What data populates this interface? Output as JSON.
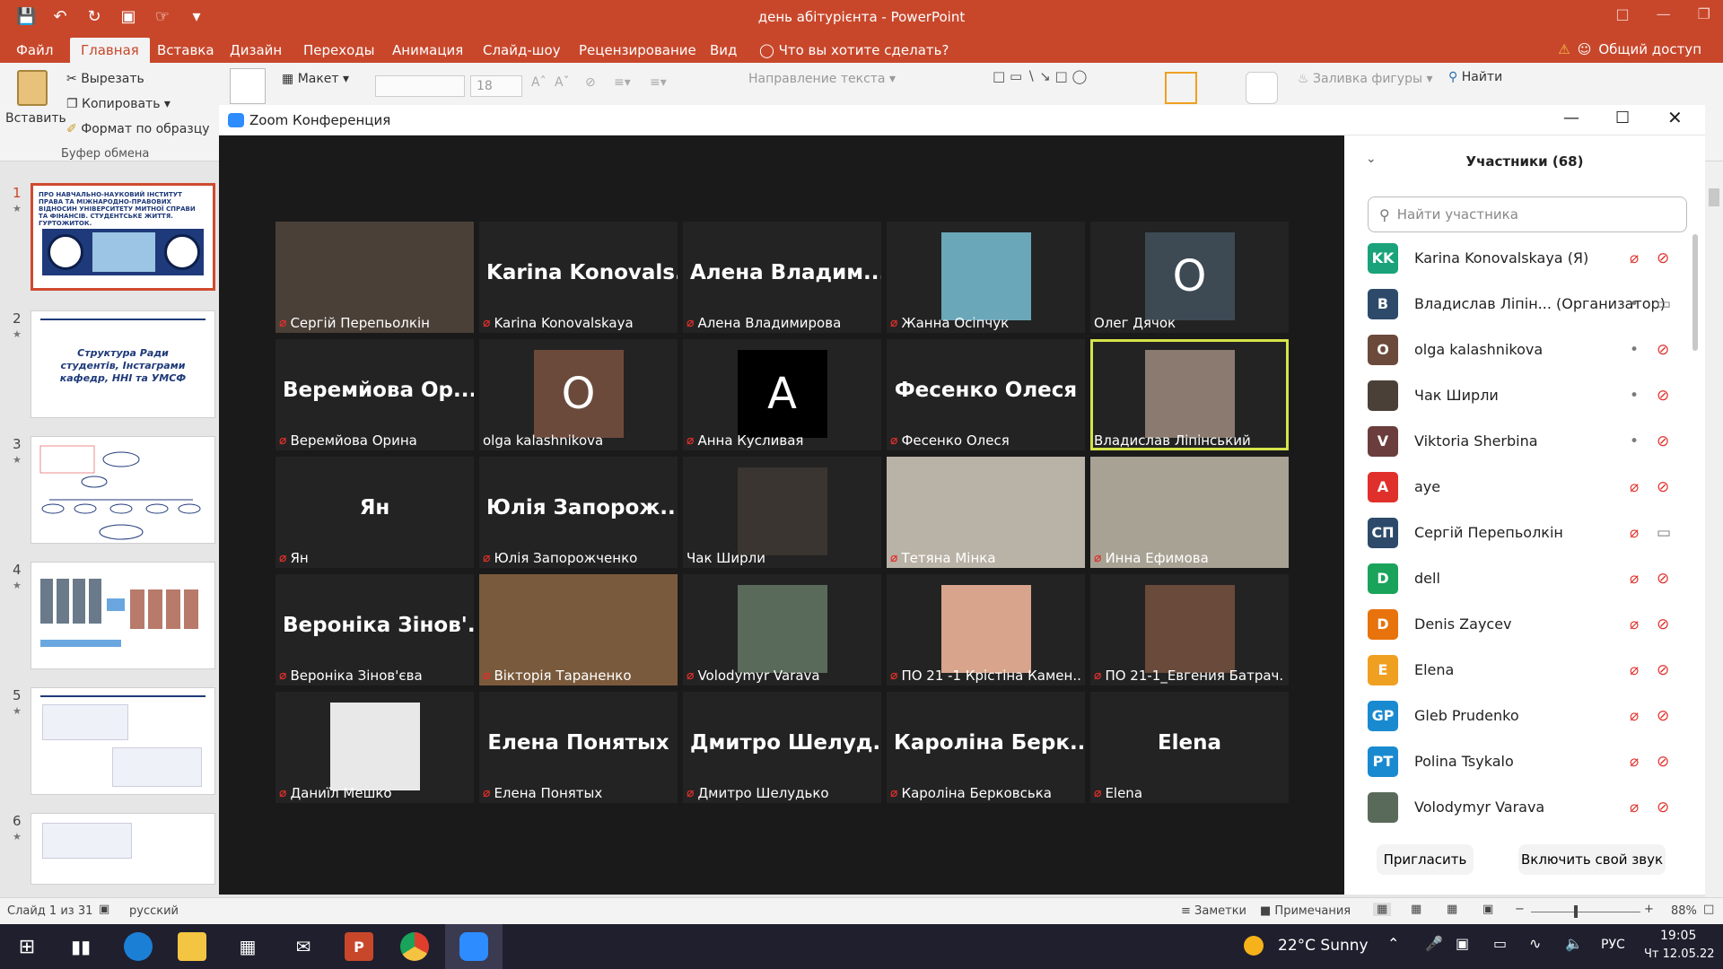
{
  "powerpoint": {
    "title": "день абітурієнта - PowerPoint",
    "tabs": [
      "Файл",
      "Главная",
      "Вставка",
      "Дизайн",
      "Переходы",
      "Анимация",
      "Слайд-шоу",
      "Рецензирование",
      "Вид"
    ],
    "tell_me": "Что вы хотите сделать?",
    "share": "Общий доступ",
    "ribbon": {
      "paste": "Вставить",
      "cut": "Вырезать",
      "copy": "Копировать",
      "format_painter": "Формат по образцу",
      "clipboard_group": "Буфер обмена",
      "layout": "Макет",
      "font_size": "18",
      "text_direction": "Направление текста",
      "shape_fill": "Заливка фигуры",
      "find": "Найти"
    },
    "slides": [
      {
        "num": "1",
        "text": "ПРО НАВЧАЛЬНО-НАУКОВИЙ ІНСТИТУТ ПРАВА ТА МІЖНАРОДНО-ПРАВОВИХ ВІДНОСИН УНІВЕРСИТЕТУ МИТНОЇ СПРАВИ ТА ФІНАНСІВ. СТУДЕНТСЬКЕ ЖИТТЯ. ГУРТОЖИТОК."
      },
      {
        "num": "2",
        "text": "Структура Ради студентів, Інстаграми кафедр, ННІ та УМСФ"
      },
      {
        "num": "3",
        "text": ""
      },
      {
        "num": "4",
        "text": ""
      },
      {
        "num": "5",
        "text": ""
      },
      {
        "num": "6",
        "text": ""
      }
    ],
    "status": {
      "slide": "Слайд 1 из 31",
      "language": "русский",
      "notes": "Заметки",
      "comments": "Примечания",
      "zoom": "88%"
    }
  },
  "zoom": {
    "window_title": "Zoom Конференция",
    "tiles": [
      {
        "label": "Сергій Перепьолкін",
        "big": "",
        "muted": true,
        "kind": "photo",
        "color": "#4a4038"
      },
      {
        "label": "Karina Konovalskaya",
        "big": "Karina  Konovals...",
        "muted": true,
        "kind": "name"
      },
      {
        "label": "Алена Владимирова",
        "big": "Алена  Владим...",
        "muted": true,
        "kind": "name"
      },
      {
        "label": "Жанна Осіпчук",
        "big": "",
        "muted": true,
        "kind": "photo-small",
        "color": "#6aa7b8"
      },
      {
        "label": "Олег Дячок",
        "big": "",
        "muted": false,
        "kind": "letter",
        "letter": "O",
        "color": "#3d4a54"
      },
      {
        "label": "Веремйова Орина",
        "big": "Веремйова  Ор...",
        "muted": true,
        "kind": "name"
      },
      {
        "label": "olga kalashnikova",
        "big": "",
        "muted": false,
        "kind": "letter",
        "letter": "O",
        "color": "#6b4a3c"
      },
      {
        "label": "Анна Кусливая",
        "big": "",
        "muted": true,
        "kind": "letter",
        "letter": "A",
        "color": "#000000"
      },
      {
        "label": "Фесенко Олеся",
        "big": "Фесенко Олеся",
        "muted": true,
        "kind": "name"
      },
      {
        "label": "Владислав Ліпінський",
        "big": "",
        "muted": false,
        "kind": "photo-small",
        "color": "#8a7a70",
        "highlight": true
      },
      {
        "label": "Ян",
        "big": "Ян",
        "muted": true,
        "kind": "name"
      },
      {
        "label": "Юлія Запорожченко",
        "big": "Юлія  Запорож...",
        "muted": true,
        "kind": "name"
      },
      {
        "label": "Чак Ширли",
        "big": "",
        "muted": false,
        "kind": "photo-small",
        "color": "#3a3530"
      },
      {
        "label": "Тетяна Мінка",
        "big": "",
        "muted": true,
        "kind": "photo",
        "color": "#b9b2a6"
      },
      {
        "label": "Инна Ефимова",
        "big": "",
        "muted": true,
        "kind": "photo",
        "color": "#a8a294"
      },
      {
        "label": "Вероніка Зінов'єва",
        "big": "Вероніка  Зінов'...",
        "muted": true,
        "kind": "name"
      },
      {
        "label": "Вікторія Тараненко",
        "big": "",
        "muted": true,
        "kind": "photo",
        "color": "#7a5a3c"
      },
      {
        "label": "Volodymyr Varava",
        "big": "",
        "muted": true,
        "kind": "photo-small",
        "color": "#5a6a5a"
      },
      {
        "label": "ПО 21 -1 Крістіна Камен...",
        "big": "",
        "muted": true,
        "kind": "photo-small",
        "color": "#d8a48c"
      },
      {
        "label": "ПО 21-1_Евгения Батрач...",
        "big": "",
        "muted": true,
        "kind": "photo-small",
        "color": "#6a4a3a"
      },
      {
        "label": "Даниїл Мешко",
        "big": "",
        "muted": true,
        "kind": "photo-small",
        "color": "#e8e8e8"
      },
      {
        "label": "Елена Понятых",
        "big": "Елена  Понятых",
        "muted": true,
        "kind": "name"
      },
      {
        "label": "Дмитро Шелудько",
        "big": "Дмитро  Шелуд...",
        "muted": true,
        "kind": "name"
      },
      {
        "label": "Кароліна Берковська",
        "big": "Кароліна  Берк...",
        "muted": true,
        "kind": "name"
      },
      {
        "label": "Elena",
        "big": "Elena",
        "muted": true,
        "kind": "name"
      }
    ],
    "participants_panel": {
      "title": "Участники (68)",
      "search_placeholder": "Найти участника",
      "invite": "Пригласить",
      "unmute": "Включить свой звук",
      "list": [
        {
          "initials": "KK",
          "name": "Karina Konovalskaya (Я)",
          "color": "#1aa37a",
          "mic_muted": true,
          "cam_off": true
        },
        {
          "initials": "B",
          "name": "Владислав Ліпін...  (Организатор)",
          "color": "#2d4a6a",
          "mic_muted": false,
          "cam_off": false
        },
        {
          "initials": "O",
          "name": "olga kalashnikova",
          "color": "#6b4a3c",
          "mic_muted": false,
          "cam_off": true
        },
        {
          "initials": "",
          "name": "Чак Ширли",
          "color": "#4a4038",
          "mic_muted": false,
          "cam_off": true
        },
        {
          "initials": "V",
          "name": "Viktoria Sherbina",
          "color": "#6b3d3d",
          "mic_muted": false,
          "cam_off": true
        },
        {
          "initials": "A",
          "name": "aye",
          "color": "#e0302b",
          "mic_muted": true,
          "cam_off": true
        },
        {
          "initials": "СП",
          "name": "Сергій Перепьолкін",
          "color": "#2d4a6a",
          "mic_muted": true,
          "cam_off": false
        },
        {
          "initials": "D",
          "name": "dell",
          "color": "#1aa35a",
          "mic_muted": true,
          "cam_off": true
        },
        {
          "initials": "D",
          "name": "Denis Zaycev",
          "color": "#e8720c",
          "mic_muted": true,
          "cam_off": true
        },
        {
          "initials": "E",
          "name": "Elena",
          "color": "#f0a020",
          "mic_muted": true,
          "cam_off": true
        },
        {
          "initials": "GP",
          "name": "Gleb Prudenko",
          "color": "#1a8ad0",
          "mic_muted": true,
          "cam_off": true
        },
        {
          "initials": "PT",
          "name": "Polina Tsykalo",
          "color": "#1a8ad0",
          "mic_muted": true,
          "cam_off": true
        },
        {
          "initials": "",
          "name": "Volodymyr Varava",
          "color": "#5a6a5a",
          "mic_muted": true,
          "cam_off": true
        }
      ]
    }
  },
  "taskbar": {
    "weather": "22°C  Sunny",
    "lang": "РУС",
    "time": "19:05",
    "date": "Чт 12.05.22"
  }
}
